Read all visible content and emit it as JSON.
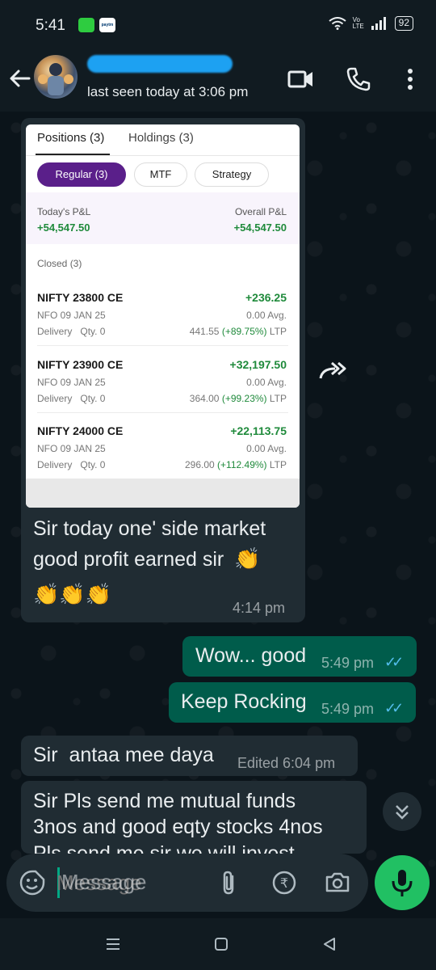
{
  "status_bar": {
    "time": "5:41",
    "notif1": "",
    "notif2": "paytm",
    "volte": "Vo LTE",
    "battery": "92"
  },
  "header": {
    "last_seen": "last seen today at 3:06 pm"
  },
  "screenshot": {
    "tab_positions": "Positions (3)",
    "tab_holdings": "Holdings (3)",
    "chip_regular": "Regular (3)",
    "chip_mtf": "MTF",
    "chip_strategy": "Strategy",
    "todays_pl_label": "Today's P&L",
    "todays_pl_value": "+54,547.50",
    "overall_pl_label": "Overall P&L",
    "overall_pl_value": "+54,547.50",
    "closed_label": "Closed (3)",
    "positions": [
      {
        "name": "NIFTY 23800 CE",
        "pl": "+236.25",
        "exchange": "NFO 09 JAN 25",
        "avg": "0.00 Avg.",
        "product": "Delivery",
        "qty": "Qty. 0",
        "ltp_price": "441.55",
        "ltp_change": "(+89.75%)",
        "ltp_suffix": "LTP"
      },
      {
        "name": "NIFTY 23900 CE",
        "pl": "+32,197.50",
        "exchange": "NFO 09 JAN 25",
        "avg": "0.00 Avg.",
        "product": "Delivery",
        "qty": "Qty. 0",
        "ltp_price": "364.00",
        "ltp_change": "(+99.23%)",
        "ltp_suffix": "LTP"
      },
      {
        "name": "NIFTY 24000 CE",
        "pl": "+22,113.75",
        "exchange": "NFO 09 JAN 25",
        "avg": "0.00 Avg.",
        "product": "Delivery",
        "qty": "Qty. 0",
        "ltp_price": "296.00",
        "ltp_change": "(+112.49%)",
        "ltp_suffix": "LTP"
      }
    ]
  },
  "messages": {
    "m1_line1": "Sir today one' side market",
    "m1_line2": "good profit earned sir",
    "m1_time": "4:14 pm",
    "m2_text": "Wow... good",
    "m2_time": "5:49 pm",
    "m3_text": "Keep Rocking",
    "m3_time": "5:49 pm",
    "m4_text": "Sir  antaa mee daya",
    "m4_time": "Edited 6:04 pm",
    "m5_line1": "Sir Pls send me mutual funds",
    "m5_line2": "3nos and good eqty stocks 4nos",
    "m5_line3": "Pls send me sir we will invest"
  },
  "input": {
    "placeholder": "Message"
  },
  "colors": {
    "incoming_bubble": "#202c33",
    "outgoing_bubble": "#005c4b",
    "accent_green": "#21c063",
    "read_ticks": "#53bdeb",
    "profit_green": "#1f8a3b",
    "active_chip": "#5a1f8a"
  }
}
